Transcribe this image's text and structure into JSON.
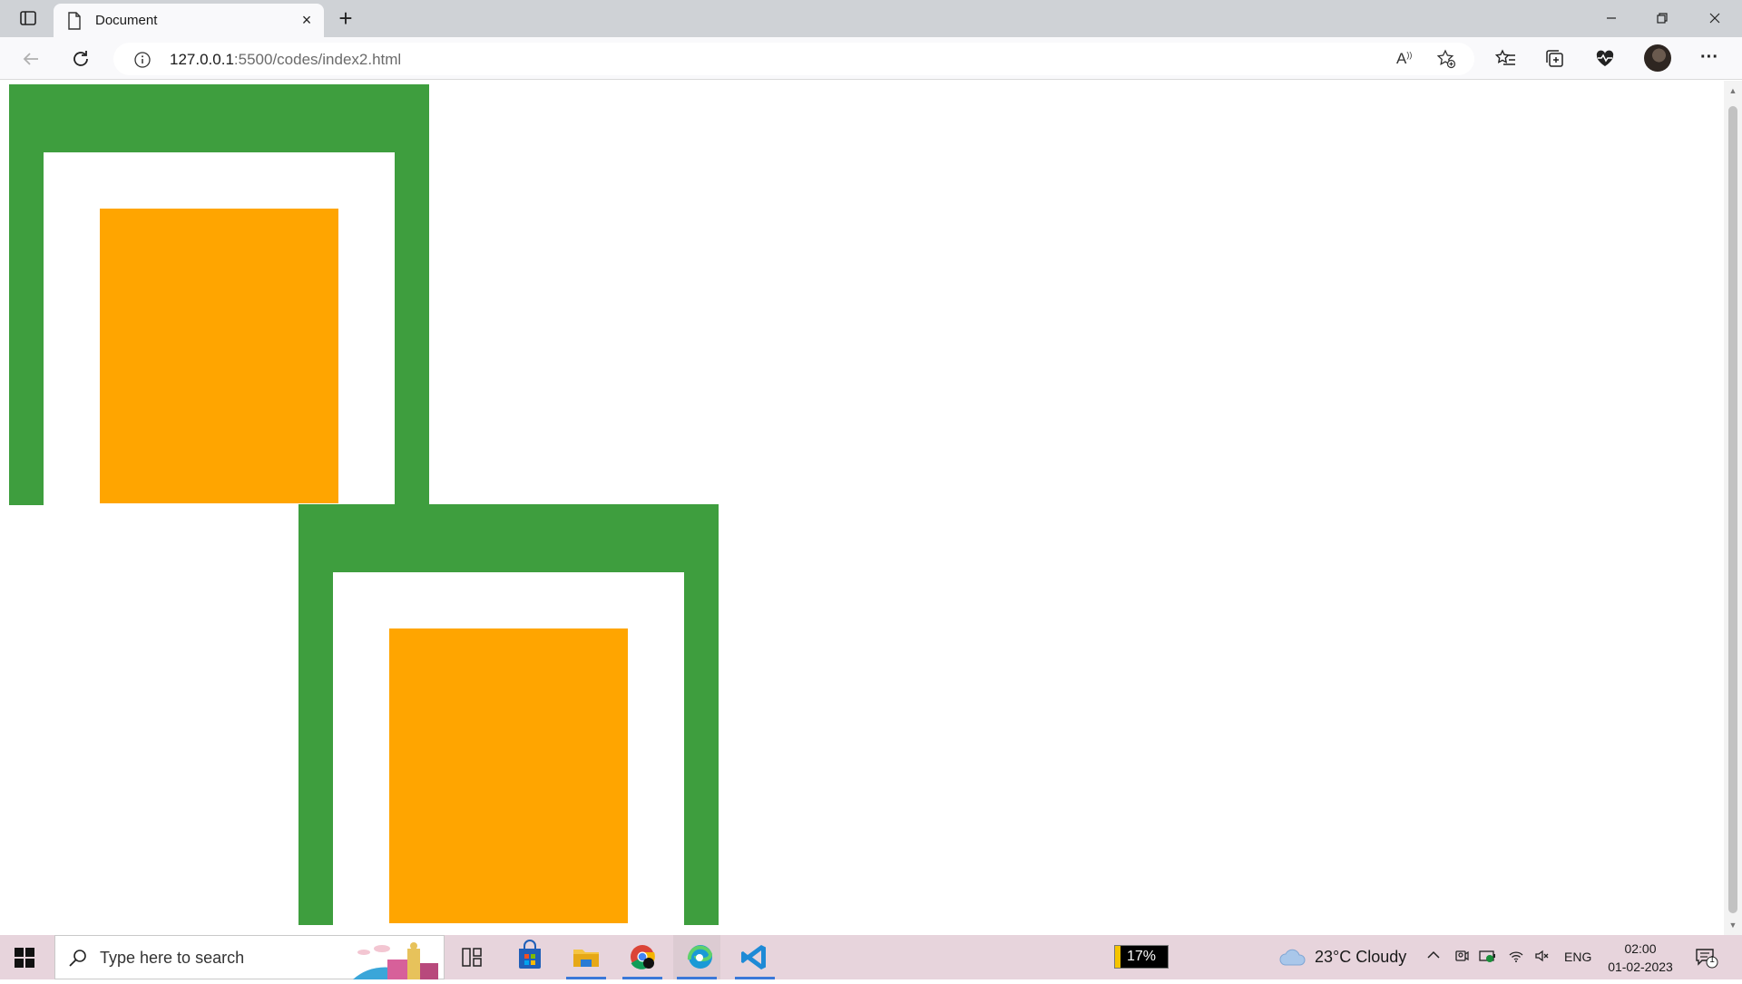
{
  "browser": {
    "tab_title": "Document",
    "url_host": "127.0.0.1",
    "url_path": ":5500/codes/index2.html"
  },
  "page": {
    "frame_color": "#3e9e3e",
    "inner_box_color": "#ffa500",
    "frames": [
      {
        "name": "frame-1"
      },
      {
        "name": "frame-2"
      }
    ]
  },
  "taskbar": {
    "search_placeholder": "Type here to search",
    "battery_percent": "17%",
    "weather": "23°C  Cloudy",
    "language": "ENG",
    "time": "02:00",
    "date": "01-02-2023",
    "notification_count": "1"
  }
}
